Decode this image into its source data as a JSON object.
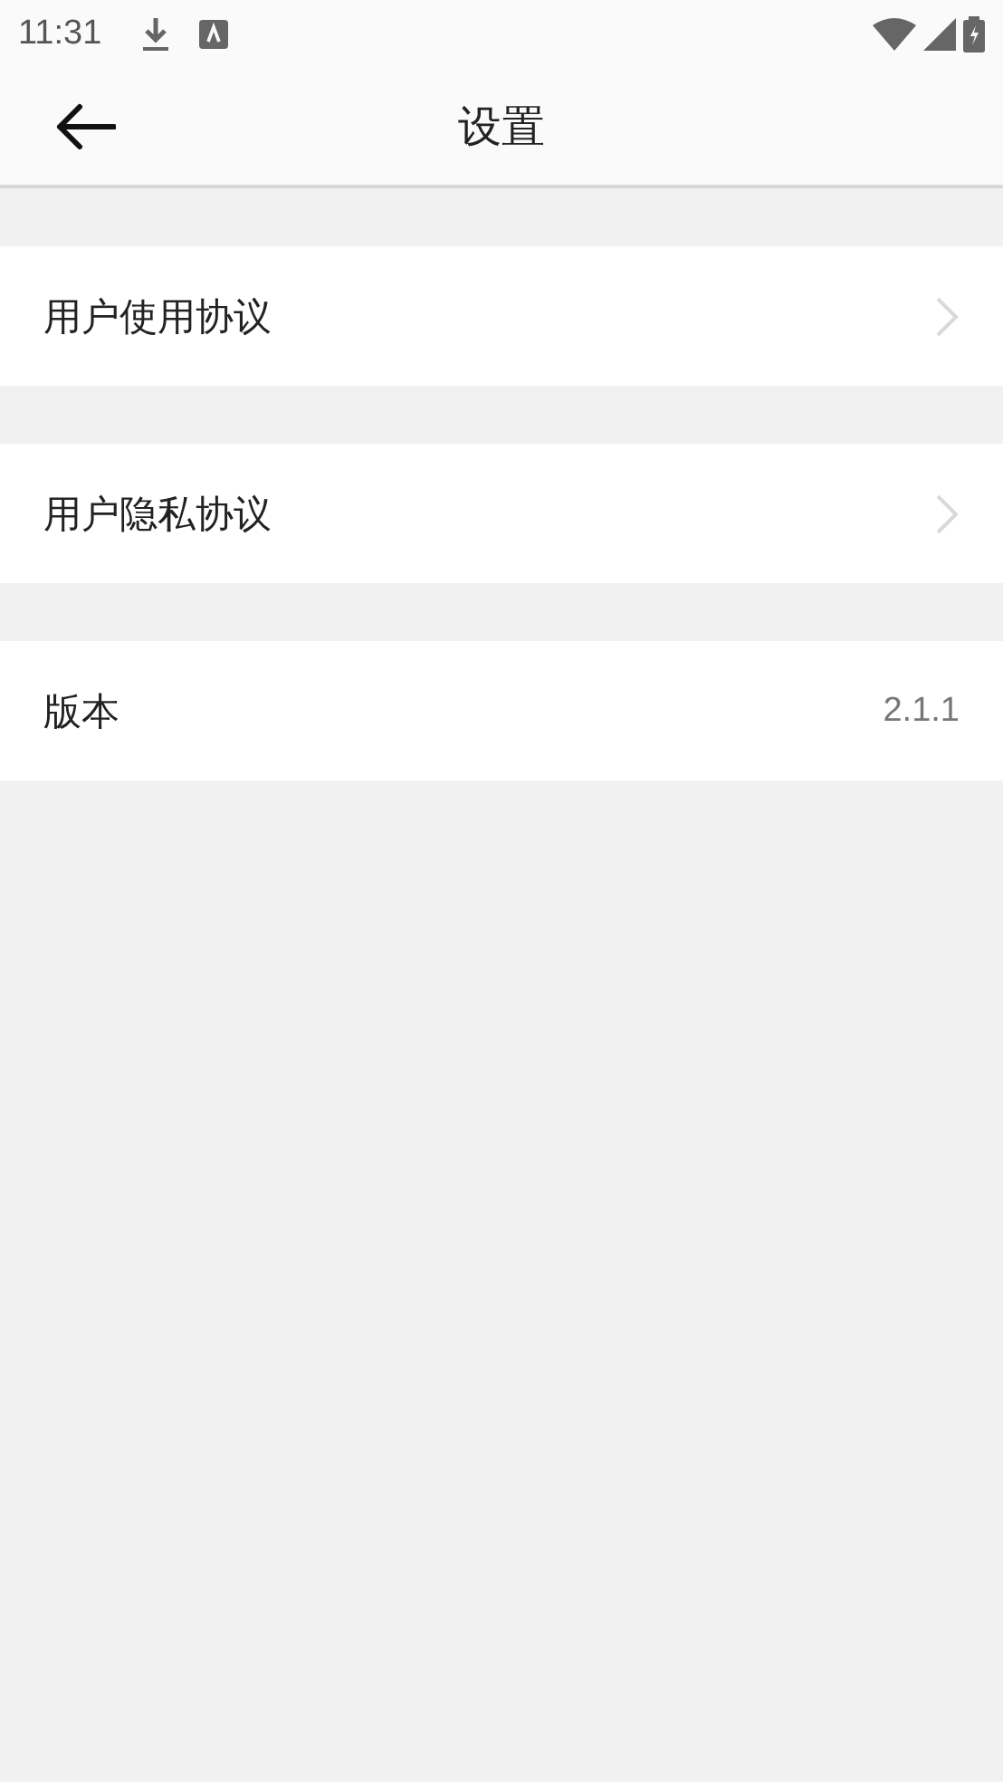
{
  "status_bar": {
    "time": "11:31"
  },
  "header": {
    "title": "设置"
  },
  "rows": [
    {
      "kind": "link",
      "label": "用户使用协议"
    },
    {
      "kind": "link",
      "label": "用户隐私协议"
    },
    {
      "kind": "value",
      "label": "版本",
      "value": "2.1.1"
    }
  ]
}
